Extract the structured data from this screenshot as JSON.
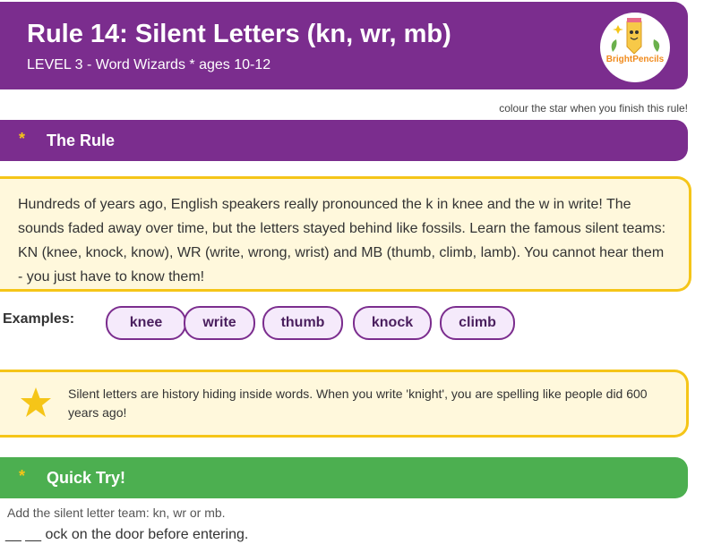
{
  "header": {
    "title": "Rule 14: Silent Letters (kn, wr, mb)",
    "subtitle": "LEVEL 3 - Word Wizards  *  ages 10-12",
    "logo_text": "BrightPencils"
  },
  "star_note": "colour the star when you finish this rule!",
  "rule_section": {
    "marker": "*",
    "title": "The Rule",
    "text": "Hundreds of years ago, English speakers really pronounced the k in knee and the w in write! The sounds faded away over time, but the letters stayed behind like fossils. Learn the famous silent teams: KN (knee, knock, know), WR (write, wrong, wrist) and MB (thumb, climb, lamb). You cannot hear them - you just have to know them!"
  },
  "examples": {
    "label": "Examples:",
    "words": [
      "knee",
      "write",
      "thumb",
      "knock",
      "climb"
    ]
  },
  "fact": {
    "icon": "star-icon",
    "text": "Silent letters are history hiding inside words. When you write 'knight', you are spelling like people did 600 years ago!"
  },
  "quick_try": {
    "marker": "*",
    "title": "Quick Try!",
    "instruction": "Add the silent letter team: kn, wr or mb.",
    "questions": [
      "__ __ ock on the door before entering."
    ]
  },
  "colors": {
    "purple": "#7b2d8e",
    "green": "#4caf50",
    "yellow": "#f5c518",
    "box_bg": "#fff8dc"
  }
}
